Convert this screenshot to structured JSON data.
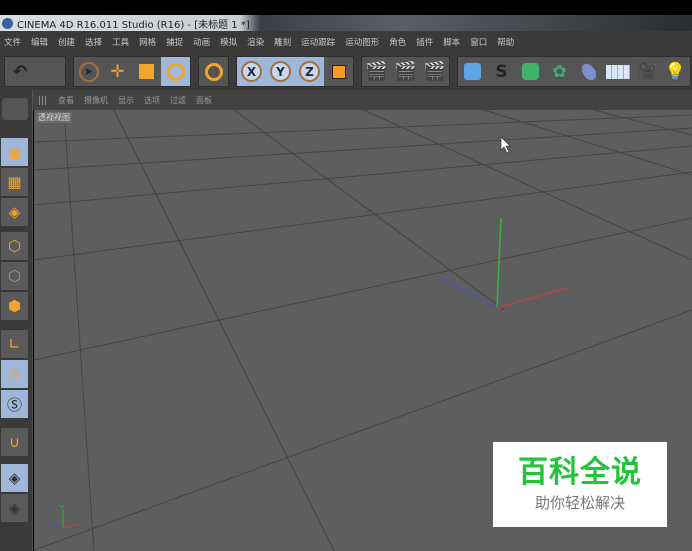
{
  "window": {
    "title": "CINEMA 4D R16.011 Studio (R16) - [未标题 1 *]"
  },
  "menu": [
    "文件",
    "编辑",
    "创建",
    "选择",
    "工具",
    "网格",
    "捕捉",
    "动画",
    "模拟",
    "渲染",
    "雕刻",
    "运动跟踪",
    "运动图形",
    "角色",
    "插件",
    "脚本",
    "窗口",
    "帮助"
  ],
  "toolbar": {
    "undo": "↶",
    "move": "✛",
    "x": "X",
    "y": "Y",
    "z": "Z"
  },
  "viewport": {
    "menu": [
      "查看",
      "摄像机",
      "显示",
      "选项",
      "过滤",
      "面板"
    ],
    "label": "透视视图",
    "axis_y": "Y"
  },
  "watermark": {
    "title": "百科全说",
    "subtitle": "助你轻松解决"
  }
}
